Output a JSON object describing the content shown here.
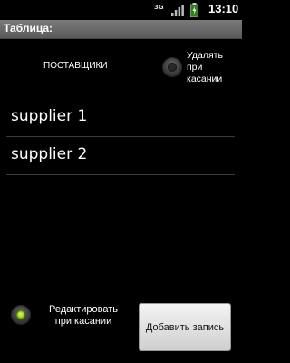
{
  "status_bar": {
    "sim_label": "3G",
    "time": "13:10"
  },
  "title_bar": {
    "title": "Таблица:"
  },
  "header": {
    "column_label": "ПОСТАВЩИКИ",
    "delete_on_touch_label": "Удалять при касании",
    "delete_on_touch_checked": false
  },
  "list": {
    "items": [
      {
        "label": "supplier 1"
      },
      {
        "label": "supplier 2"
      }
    ]
  },
  "footer": {
    "edit_on_touch_label": "Редактировать при касании",
    "edit_on_touch_checked": true,
    "add_button_label": "Добавить запись"
  },
  "colors": {
    "background": "#000000",
    "title_bar": "#6a6a6a",
    "radio_on": "#8fd400",
    "button": "#e6e6e6"
  },
  "icons": [
    "sim-icon",
    "signal-icon",
    "battery-icon",
    "radio-off-icon",
    "radio-on-icon"
  ]
}
